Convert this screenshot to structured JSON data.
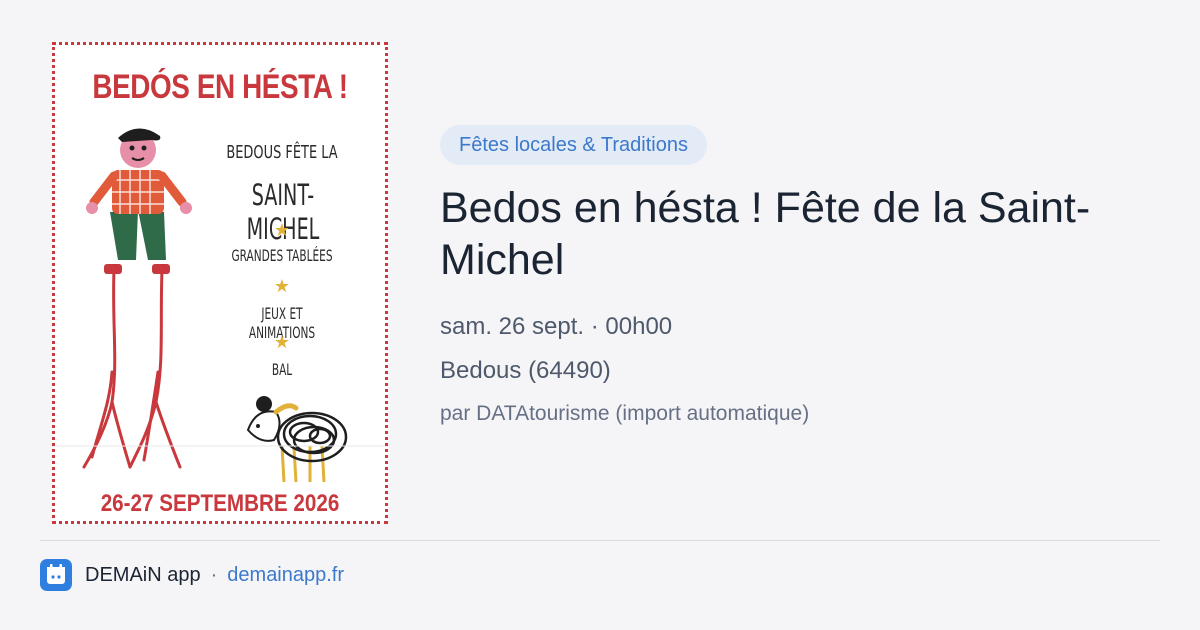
{
  "poster": {
    "title": "BEDÓS EN HÉSTA !",
    "line1": "BEDOUS FÊTE LA",
    "line2": "SAINT-MICHEL",
    "items": [
      "GRANDES TABLÉES",
      "JEUX ET ANIMATIONS",
      "BAL"
    ],
    "star": "★",
    "dates": "26-27 SEPTEMBRE 2026"
  },
  "event": {
    "category": "Fêtes locales & Traditions",
    "title": "Bedos en hésta ! Fête de la Saint-Michel",
    "datetime": "sam. 26 sept. · 00h00",
    "place": "Bedous (64490)",
    "source": "par DATAtourisme (import automatique)"
  },
  "footer": {
    "app_name": "DEMAiN app",
    "separator": "·",
    "link": "demainapp.fr"
  },
  "colors": {
    "accent": "#3c79cc",
    "poster_red": "#c8383d",
    "star_yellow": "#e2b13a"
  }
}
